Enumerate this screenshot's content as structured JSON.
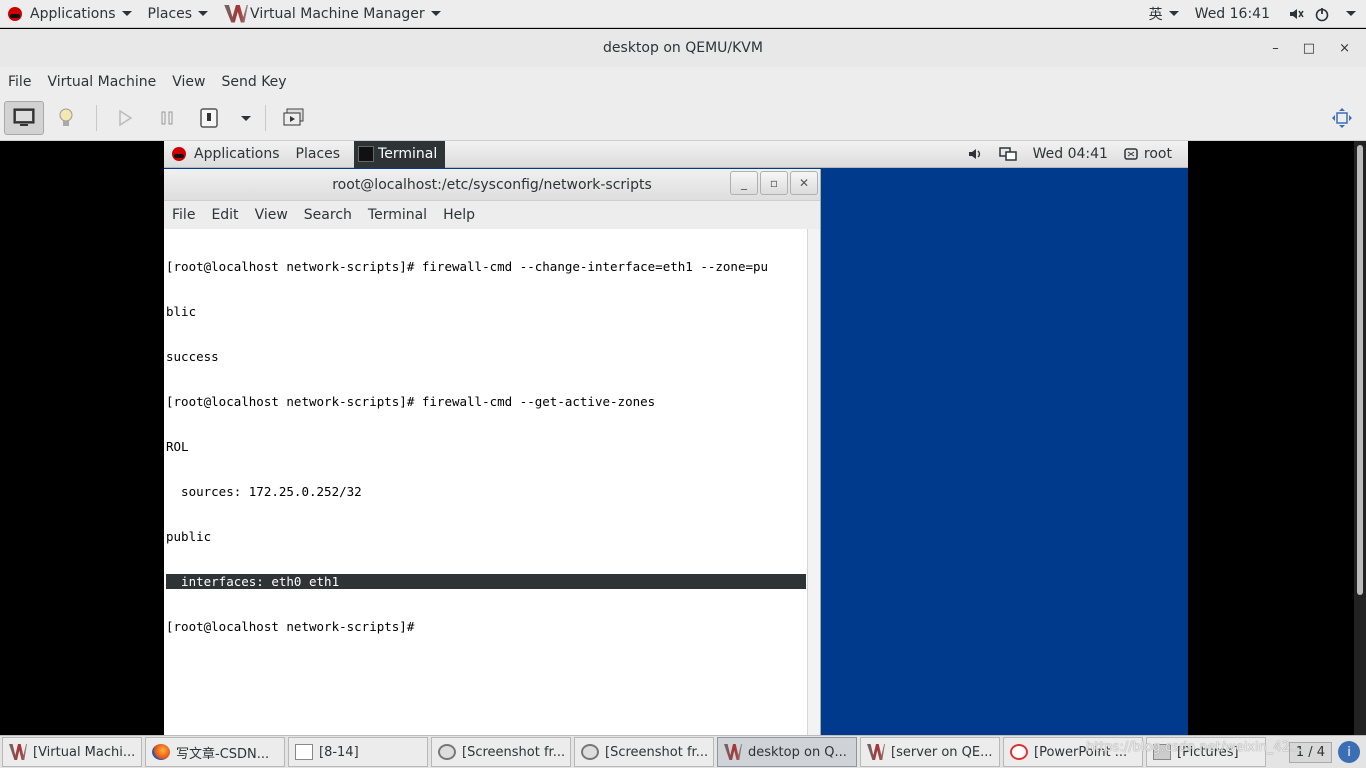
{
  "host_panel": {
    "applications": "Applications",
    "places": "Places",
    "app_name": "Virtual Machine Manager",
    "input_method": "英",
    "clock": "Wed 16:41"
  },
  "window": {
    "title": "desktop on QEMU/KVM",
    "minimize": "–",
    "maximize": "□",
    "close": "×",
    "menu": [
      "File",
      "Virtual Machine",
      "View",
      "Send Key"
    ]
  },
  "guest_panel": {
    "applications": "Applications",
    "places": "Places",
    "active_app": "Terminal",
    "clock": "Wed 04:41",
    "user": "root"
  },
  "terminal": {
    "title": "root@localhost:/etc/sysconfig/network-scripts",
    "menu": [
      "File",
      "Edit",
      "View",
      "Search",
      "Terminal",
      "Help"
    ],
    "lines": [
      "[root@localhost network-scripts]# firewall-cmd --change-interface=eth1 --zone=pu",
      "blic",
      "success",
      "[root@localhost network-scripts]# firewall-cmd --get-active-zones",
      "ROL",
      "  sources: 172.25.0.252/32",
      "public",
      "  interfaces: eth0 eth1",
      "[root@localhost network-scripts]#"
    ],
    "highlighted_line_index": 7
  },
  "taskbar": {
    "tasks": [
      {
        "label": "[Virtual Machi...",
        "icon": "vmm-icon",
        "active": false
      },
      {
        "label": "写文章-CSDN...",
        "icon": "firefox-icon",
        "active": false
      },
      {
        "label": "[8-14]",
        "icon": "document-icon",
        "active": false
      },
      {
        "label": "[Screenshot fr...",
        "icon": "screenshot-icon",
        "active": false
      },
      {
        "label": "[Screenshot fr...",
        "icon": "screenshot-icon",
        "active": false
      },
      {
        "label": "desktop on Q...",
        "icon": "vmm-icon",
        "active": true
      },
      {
        "label": "[server on QE...",
        "icon": "vmm-icon",
        "active": false
      },
      {
        "label": "[PowerPoint ...",
        "icon": "powerpoint-icon",
        "active": false
      },
      {
        "label": "[Pictures]",
        "icon": "folder-icon",
        "active": false
      }
    ],
    "workspace": "1 / 4",
    "watermark": "https://blog.csdn.net/weixin_42..."
  }
}
